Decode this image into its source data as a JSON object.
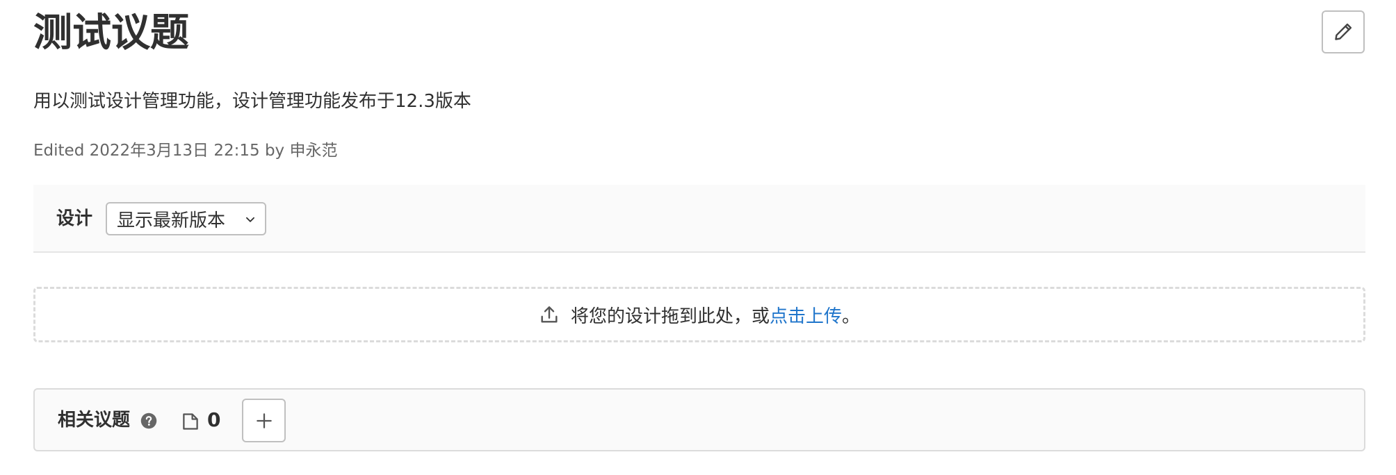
{
  "issue": {
    "title": "测试议题",
    "description": "用以测试设计管理功能，设计管理功能发布于12.3版本",
    "edited_prefix": "Edited 2022年3月13日 22:15 by ",
    "edited_author": "申永范"
  },
  "designs": {
    "label": "设计",
    "version_selected": "显示最新版本",
    "dropzone_text": "将您的设计拖到此处，或 ",
    "dropzone_link": "点击上传",
    "dropzone_suffix": "。"
  },
  "related_issues": {
    "label": "相关议题",
    "count": "0"
  },
  "icons": {
    "edit": "pencil-icon",
    "dropdown": "chevron-down-icon",
    "upload": "upload-icon",
    "help": "question-circle-icon",
    "issue": "issue-icon",
    "add": "plus-icon"
  },
  "colors": {
    "link": "#1f75cb",
    "text": "#303030",
    "muted": "#666666",
    "panel_bg": "#fafafa"
  }
}
